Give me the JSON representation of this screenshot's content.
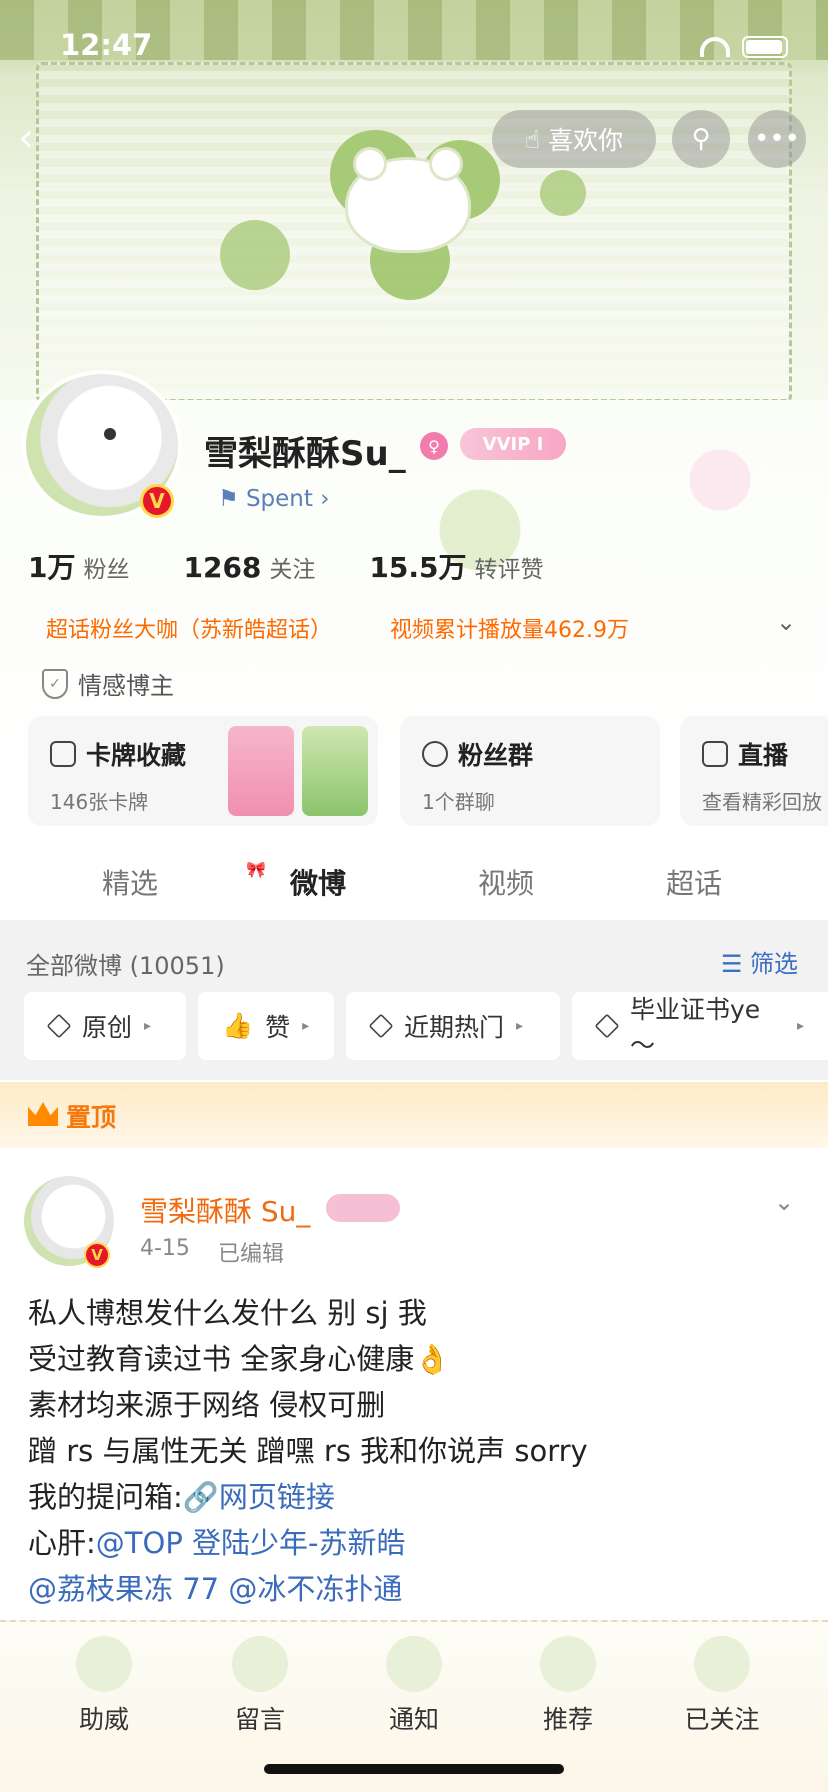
{
  "status_bar": {
    "time": "12:47"
  },
  "header": {
    "like_label": "喜欢你"
  },
  "profile": {
    "nickname": "雪梨酥酥Su_",
    "vip_badge": "VVIP I",
    "status_text": "Spent",
    "stats": [
      {
        "value": "1万",
        "label": "粉丝"
      },
      {
        "value": "1268",
        "label": "关注"
      },
      {
        "value": "15.5万",
        "label": "转评赞"
      }
    ],
    "tags": [
      "超话粉丝大咖（苏新皓超话）",
      "视频累计播放量462.9万"
    ],
    "verification": "情感博主"
  },
  "cards": [
    {
      "title": "卡牌收藏",
      "sub": "146张卡牌"
    },
    {
      "title": "粉丝群",
      "sub": "1个群聊"
    },
    {
      "title": "直播",
      "sub": "查看精彩回放"
    }
  ],
  "tabs": [
    "精选",
    "微博",
    "视频",
    "超话"
  ],
  "active_tab": "微博",
  "feed": {
    "all_count": "全部微博 (10051)",
    "filter_label": "筛选",
    "chips": [
      "原创",
      "赞",
      "近期热门",
      "毕业证书ye～"
    ]
  },
  "pinned": {
    "label": "置顶"
  },
  "post": {
    "author": "雪梨酥酥 Su_",
    "date": "4-15",
    "edited": "已编辑",
    "lines": [
      "私人博想发什么发什么 别 sj 我",
      "受过教育读过书 全家身心健康👌",
      "素材均来源于网络 侵权可删",
      "蹭 rs 与属性无关 蹭嘿 rs 我和你说声 sorry"
    ],
    "question_prefix": "我的提问箱:",
    "question_link": "🔗网页链接",
    "heart_prefix": "心肝:",
    "heart_link": "@TOP 登陆少年-苏新皓",
    "mentions": "@荔枝果冻 77 @冰不冻扑通"
  },
  "bottom_bar": [
    "助威",
    "留言",
    "通知",
    "推荐",
    "已关注"
  ],
  "colors": {
    "accent_orange": "#f06b10",
    "link_blue": "#3b6cbb",
    "tag_orange": "#ff6a00"
  }
}
